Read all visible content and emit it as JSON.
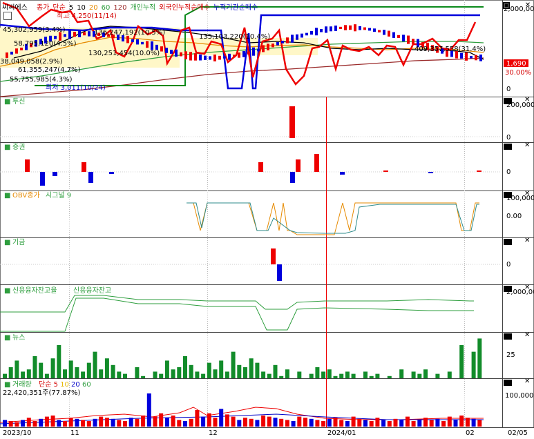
{
  "header": {
    "title": "씨씨에스",
    "legend": [
      {
        "text": "종가",
        "color": "#d40000"
      },
      {
        "text": "단순",
        "color": "#d40000"
      },
      {
        "text": "5",
        "color": "#000000"
      },
      {
        "text": "10",
        "color": "#000000"
      },
      {
        "text": "20",
        "color": "#e68a00"
      },
      {
        "text": "60",
        "color": "#2e9e3e"
      },
      {
        "text": "120",
        "color": "#9b2b2b"
      },
      {
        "text": "개인누적",
        "color": "#2e9e3e"
      },
      {
        "text": "외국인누적순매수",
        "color": "#d40000"
      },
      {
        "text": "누적기관순매수",
        "color": "#0000c8"
      }
    ]
  },
  "price_panel": {
    "annotations": [
      "최고 4,250(11/14)",
      "45,302,959(3.4%)",
      "136,247,192(10.5%)",
      "58,795,120(4.5%)",
      "135,103,220(10.4%)",
      "130,251,454(10.0%)",
      "38,049,058(2.9%)",
      "61,355,247(4.7%)",
      "55,755,985(4.3%)",
      "최저 3,011(10/24)",
      "409,357,558(31.4%)"
    ],
    "scale_labels": [
      "2,000,00",
      "1,690",
      "30.00%"
    ]
  },
  "panels": {
    "investment": {
      "title": "투신",
      "scale": [
        "200,000",
        "0"
      ]
    },
    "securities": {
      "title": "증권",
      "scale": [
        "0"
      ]
    },
    "obv": {
      "title": "OBV종가",
      "signal": "시그널 9",
      "scale": [
        "100,000,",
        "0.00"
      ]
    },
    "pension": {
      "title": "기금",
      "scale": [
        "0"
      ]
    },
    "credit": {
      "title": "신용융자잔고율",
      "title2": "신용융자잔고",
      "scale": [
        "2,000,00"
      ]
    },
    "news": {
      "title": "뉴스",
      "scale": [
        "25"
      ]
    },
    "volume": {
      "title": "거래량",
      "ma_legend": [
        {
          "text": "단순",
          "color": "#d40000"
        },
        {
          "text": "5",
          "color": "#d40000"
        },
        {
          "text": "10",
          "color": "#e6b800"
        },
        {
          "text": "20",
          "color": "#0000c8"
        },
        {
          "text": "60",
          "color": "#2e9e3e"
        }
      ],
      "readout": "22,420,351주(77.87%)",
      "scale": [
        "100,000,"
      ]
    }
  },
  "x_axis": {
    "labels": [
      "2023/10",
      "11",
      "12",
      "2024/01",
      "02",
      "02/05"
    ]
  },
  "chart_data": {
    "type": "bar",
    "title": "씨씨에스",
    "investment_values": [
      0,
      0,
      0,
      0,
      0,
      0,
      0,
      0,
      0,
      0,
      0,
      0,
      0,
      0,
      0,
      0,
      0,
      0,
      0,
      0,
      0,
      0,
      0,
      0,
      0,
      0,
      0,
      0,
      0,
      0,
      0,
      0,
      0,
      0,
      0,
      0,
      0,
      0,
      0,
      0,
      0,
      0,
      0,
      0,
      0,
      0,
      0,
      0,
      0,
      0,
      0,
      0,
      0,
      0,
      0,
      0,
      0,
      0,
      0,
      0,
      0,
      0,
      0,
      0,
      0,
      0,
      0,
      0,
      0,
      0,
      0,
      0,
      0,
      0,
      0,
      0,
      0,
      0,
      0,
      0,
      0,
      0,
      0,
      0,
      0,
      0,
      0,
      0,
      0,
      0,
      0,
      0,
      0,
      0,
      0,
      0,
      0,
      0,
      0,
      0
    ],
    "news_values": [
      2,
      5,
      8,
      3,
      4,
      10,
      7,
      2,
      9,
      15,
      4,
      8,
      5,
      3,
      7,
      12,
      4,
      9,
      6,
      3,
      2,
      0,
      5,
      1,
      0,
      3,
      2,
      8,
      4,
      5,
      10,
      6,
      3,
      2,
      7,
      4,
      8,
      3,
      12,
      6,
      5,
      9,
      7,
      3,
      2,
      6,
      1,
      4,
      0,
      3,
      0,
      2,
      5,
      3,
      4,
      1,
      2,
      3,
      2,
      0,
      3,
      1,
      2,
      0,
      1,
      0,
      4,
      0,
      3,
      2,
      4,
      0,
      2,
      0,
      3,
      0,
      15,
      0,
      12,
      18
    ],
    "volume_values": [
      6,
      5,
      4,
      6,
      8,
      5,
      7,
      9,
      10,
      6,
      5,
      8,
      7,
      6,
      5,
      7,
      9,
      8,
      7,
      6,
      5,
      8,
      7,
      10,
      30,
      9,
      12,
      8,
      10,
      6,
      5,
      7,
      15,
      9,
      12,
      8,
      16,
      11,
      9,
      6,
      8,
      7,
      6,
      10,
      9,
      8,
      7,
      6,
      5,
      9,
      8,
      7,
      6,
      5,
      7,
      8,
      6,
      5,
      9,
      7,
      6,
      5,
      8,
      6,
      5,
      7,
      6,
      9,
      5,
      6,
      8,
      6,
      7,
      5,
      9,
      6,
      10,
      8,
      7,
      6
    ],
    "pension_values": [
      0,
      0,
      0,
      0,
      0,
      0,
      0,
      0,
      0,
      0,
      0,
      0,
      0,
      0,
      0,
      0,
      0,
      0,
      0,
      0,
      0,
      0,
      0,
      0,
      0,
      0,
      0,
      0,
      0,
      0,
      0,
      0,
      0,
      0,
      0,
      0,
      0,
      0,
      0,
      0,
      0,
      0,
      0,
      0,
      0,
      0,
      0,
      0,
      0,
      0,
      0,
      0,
      0,
      0,
      0,
      0,
      0,
      0,
      0,
      0,
      0,
      0,
      0,
      0,
      0,
      0,
      0,
      0,
      0,
      0,
      0,
      0,
      0,
      0,
      0,
      0,
      0,
      0,
      0,
      0
    ],
    "ylabel": "",
    "xlabel": ""
  }
}
